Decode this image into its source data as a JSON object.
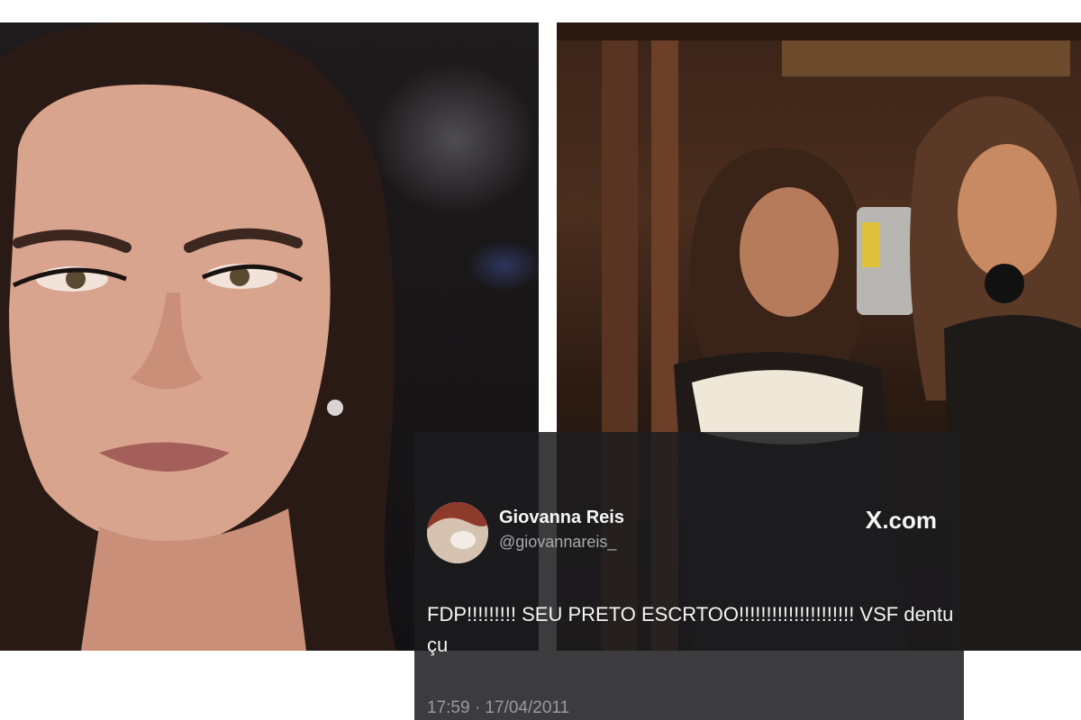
{
  "images": {
    "left_photo": {
      "description_icon": "portrait-photo"
    },
    "right_photo": {
      "description_icon": "mirror-selfie-photo"
    }
  },
  "tweet": {
    "display_name": "Giovanna Reis",
    "handle": "@giovannareis_",
    "brand_logo": "X",
    "brand_suffix": ".com",
    "text": "FDP!!!!!!!!! SEU PRETO ESCRTOO!!!!!!!!!!!!!!!!!!!!! VSF dentuçu",
    "timestamp": "17:59 · 17/04/2011"
  },
  "colors": {
    "card_background": "#1c1c1e",
    "name": "#f5f5f5",
    "handle": "#a9a9ad",
    "timestamp": "#9a9a9e",
    "page_background": "#ffffff"
  }
}
